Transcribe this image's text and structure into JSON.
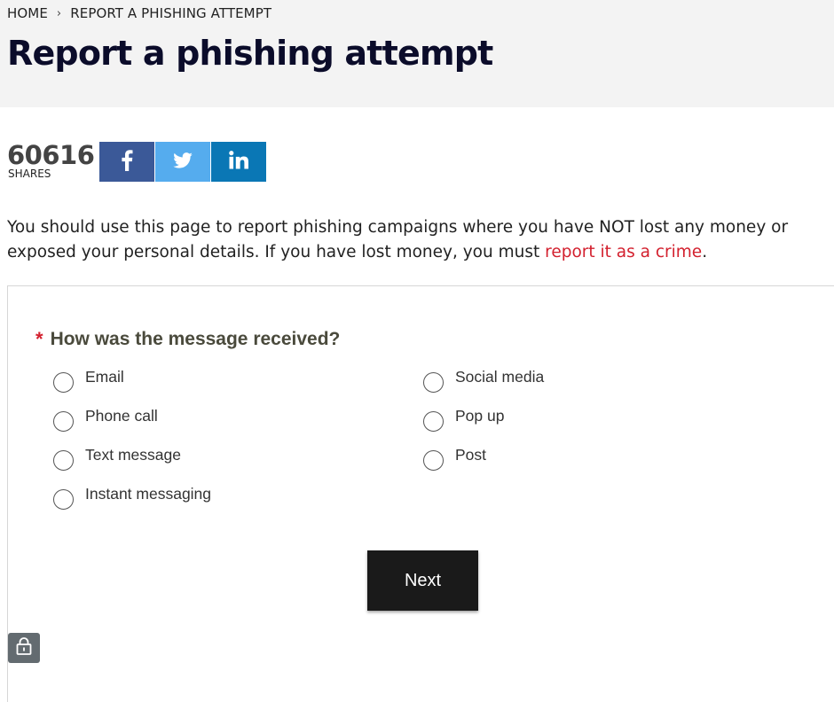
{
  "breadcrumb": {
    "items": [
      "HOME",
      "REPORT A PHISHING ATTEMPT"
    ],
    "separator": "›"
  },
  "page": {
    "title": "Report a phishing attempt"
  },
  "share": {
    "count": "60616",
    "label": "SHARES",
    "buttons": [
      {
        "icon": "facebook-icon",
        "color": "#3b5998"
      },
      {
        "icon": "twitter-icon",
        "color": "#55acee"
      },
      {
        "icon": "linkedin-icon",
        "color": "#0a77b5"
      }
    ]
  },
  "intro": {
    "text_before": "You should use this page to report phishing campaigns where you have NOT lost any money or exposed your personal details. If you have lost money, you must ",
    "link_text": "report it as a crime",
    "text_after": "."
  },
  "form": {
    "required_marker": "*",
    "question": "How was the message received?",
    "options": [
      "Email",
      "Phone call",
      "Text message",
      "Instant messaging",
      "Social media",
      "Pop up",
      "Post"
    ],
    "next_label": "Next"
  },
  "colors": {
    "accent_red": "#d3202e",
    "title_navy": "#0b0c2a",
    "button_dark": "#1a1a1a"
  }
}
